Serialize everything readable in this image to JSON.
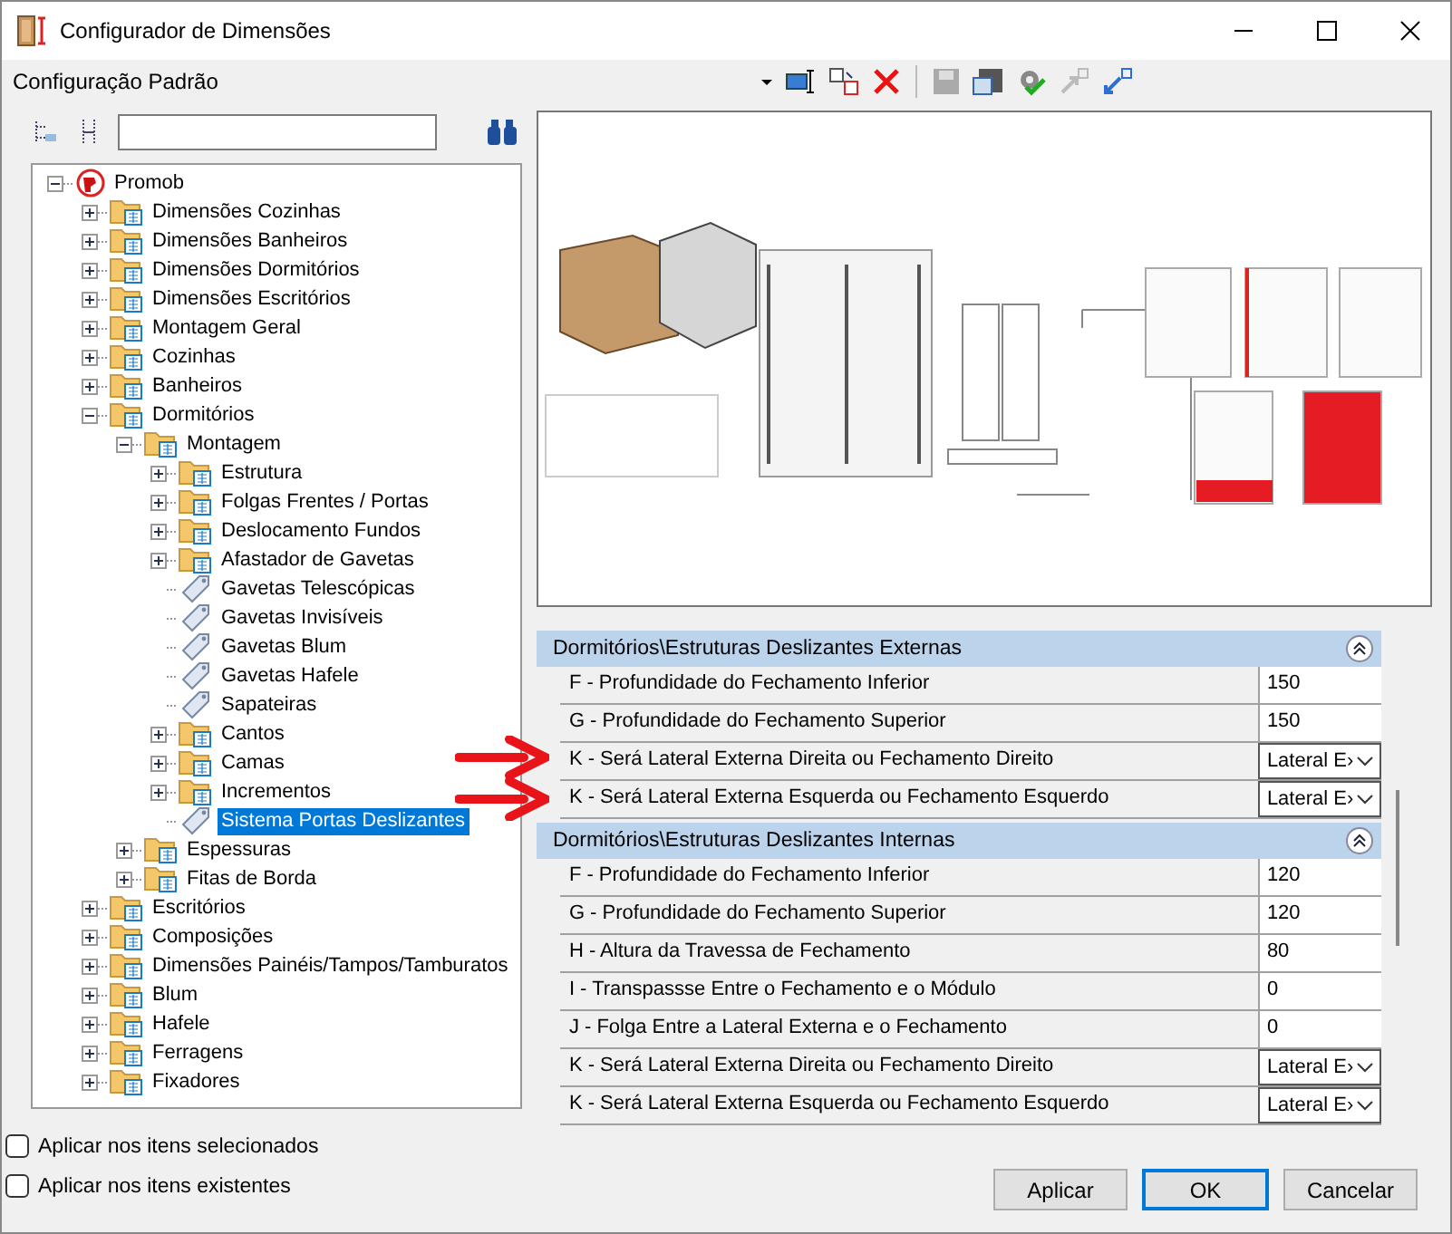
{
  "window": {
    "title": "Configurador de Dimensões"
  },
  "config_dropdown": {
    "value": "Configuração Padrão"
  },
  "tree": [
    {
      "label": "Promob",
      "kind": "root",
      "expanded": true,
      "selected": false,
      "children": [
        {
          "label": "Dimensões Cozinhas",
          "kind": "folder",
          "expanded": false,
          "selected": false
        },
        {
          "label": "Dimensões Banheiros",
          "kind": "folder",
          "expanded": false,
          "selected": false
        },
        {
          "label": "Dimensões Dormitórios",
          "kind": "folder",
          "expanded": false,
          "selected": false
        },
        {
          "label": "Dimensões Escritórios",
          "kind": "folder",
          "expanded": false,
          "selected": false
        },
        {
          "label": "Montagem Geral",
          "kind": "folder",
          "expanded": false,
          "selected": false
        },
        {
          "label": "Cozinhas",
          "kind": "folder",
          "expanded": false,
          "selected": false
        },
        {
          "label": "Banheiros",
          "kind": "folder",
          "expanded": false,
          "selected": false
        },
        {
          "label": "Dormitórios",
          "kind": "folder",
          "expanded": true,
          "selected": false,
          "children": [
            {
              "label": "Montagem",
              "kind": "folder",
              "expanded": true,
              "selected": false,
              "children": [
                {
                  "label": "Estrutura",
                  "kind": "folder",
                  "expanded": false,
                  "selected": false
                },
                {
                  "label": "Folgas Frentes / Portas",
                  "kind": "folder",
                  "expanded": false,
                  "selected": false
                },
                {
                  "label": "Deslocamento Fundos",
                  "kind": "folder",
                  "expanded": false,
                  "selected": false
                },
                {
                  "label": "Afastador de Gavetas",
                  "kind": "folder",
                  "expanded": false,
                  "selected": false
                },
                {
                  "label": "Gavetas Telescópicas",
                  "kind": "leaf",
                  "selected": false
                },
                {
                  "label": "Gavetas Invisíveis",
                  "kind": "leaf",
                  "selected": false
                },
                {
                  "label": "Gavetas Blum",
                  "kind": "leaf",
                  "selected": false
                },
                {
                  "label": "Gavetas Hafele",
                  "kind": "leaf",
                  "selected": false
                },
                {
                  "label": "Sapateiras",
                  "kind": "leaf",
                  "selected": false
                },
                {
                  "label": "Cantos",
                  "kind": "folder",
                  "expanded": false,
                  "selected": false
                },
                {
                  "label": "Camas",
                  "kind": "folder",
                  "expanded": false,
                  "selected": false
                },
                {
                  "label": "Incrementos",
                  "kind": "folder",
                  "expanded": false,
                  "selected": false
                },
                {
                  "label": "Sistema Portas Deslizantes",
                  "kind": "leaf",
                  "selected": true
                }
              ]
            },
            {
              "label": "Espessuras",
              "kind": "folder",
              "expanded": false,
              "selected": false
            },
            {
              "label": "Fitas de Borda",
              "kind": "folder",
              "expanded": false,
              "selected": false
            }
          ]
        },
        {
          "label": "Escritórios",
          "kind": "folder",
          "expanded": false,
          "selected": false
        },
        {
          "label": "Composições",
          "kind": "folder",
          "expanded": false,
          "selected": false
        },
        {
          "label": "Dimensões Painéis/Tampos/Tamburatos",
          "kind": "folder",
          "expanded": false,
          "selected": false
        },
        {
          "label": "Blum",
          "kind": "folder",
          "expanded": false,
          "selected": false
        },
        {
          "label": "Hafele",
          "kind": "folder",
          "expanded": false,
          "selected": false
        },
        {
          "label": "Ferragens",
          "kind": "folder",
          "expanded": false,
          "selected": false
        },
        {
          "label": "Fixadores",
          "kind": "folder",
          "expanded": false,
          "selected": false
        }
      ]
    }
  ],
  "property_groups": [
    {
      "title": "Dormitórios\\Estruturas Deslizantes Externas",
      "expanded": true,
      "rows": [
        {
          "label": "F - Profundidade do Fechamento Inferior",
          "kind": "text",
          "value": "150"
        },
        {
          "label": "G - Profundidade do Fechamento Superior",
          "kind": "text",
          "value": "150"
        },
        {
          "label": "K - Será Lateral Externa Direita ou Fechamento Direito",
          "kind": "dropdown",
          "value": "Lateral E›"
        },
        {
          "label": "K - Será Lateral Externa Esquerda ou Fechamento Esquerdo",
          "kind": "dropdown",
          "value": "Lateral E›"
        }
      ]
    },
    {
      "title": "Dormitórios\\Estruturas Deslizantes Internas",
      "expanded": true,
      "rows": [
        {
          "label": "F - Profundidade do Fechamento Inferior",
          "kind": "text",
          "value": "120"
        },
        {
          "label": "G - Profundidade do Fechamento Superior",
          "kind": "text",
          "value": "120"
        },
        {
          "label": "H - Altura da Travessa de Fechamento",
          "kind": "text",
          "value": "80"
        },
        {
          "label": "I - Transpassse Entre o Fechamento e o Módulo",
          "kind": "text",
          "value": "0"
        },
        {
          "label": "J - Folga Entre a Lateral Externa e o Fechamento",
          "kind": "text",
          "value": "0"
        },
        {
          "label": "K - Será Lateral Externa Direita ou Fechamento Direito",
          "kind": "dropdown",
          "value": "Lateral E›"
        },
        {
          "label": "K - Será Lateral Externa Esquerda ou Fechamento Esquerdo",
          "kind": "dropdown",
          "value": "Lateral E›"
        }
      ]
    }
  ],
  "options": [
    {
      "label": "Aplicar nos itens selecionados",
      "checked": false
    },
    {
      "label": "Aplicar nos itens existentes",
      "checked": false
    }
  ],
  "buttons": [
    "Aplicar",
    "OK",
    "Cancelar"
  ]
}
